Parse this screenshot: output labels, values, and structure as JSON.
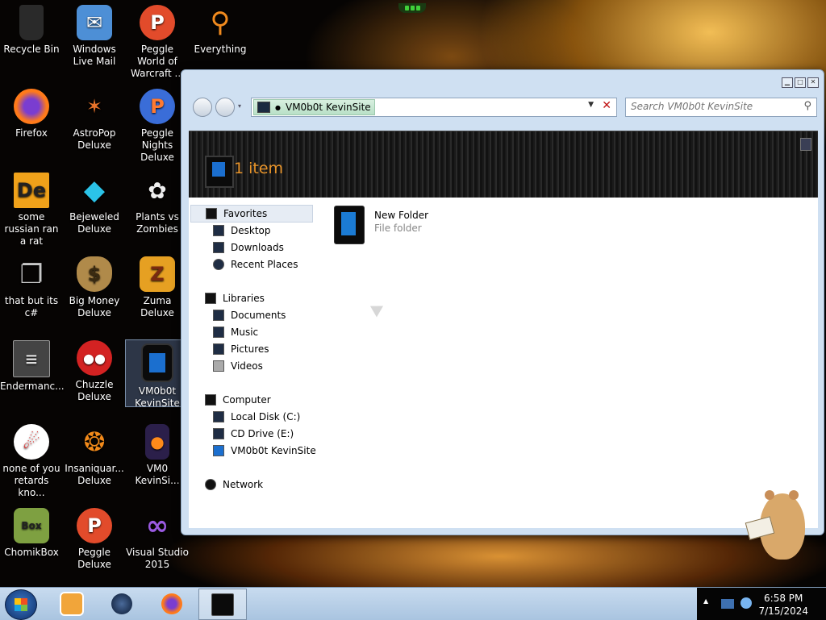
{
  "desktop": {
    "icons": [
      {
        "label": "Recycle Bin",
        "icon": "recycle-bin-icon",
        "color": "#2a2a2a"
      },
      {
        "label": "Windows Live Mail",
        "icon": "mail-icon",
        "color": "#4d8fd6"
      },
      {
        "label": "Peggle World of Warcraft ...",
        "icon": "peggle-icon",
        "color": "#e24b2b"
      },
      {
        "label": "Everything",
        "icon": "magnifier-icon",
        "color": "#f08a1e"
      },
      {
        "label": "Firefox",
        "icon": "firefox-icon",
        "color": "#ff7a1a"
      },
      {
        "label": "AstroPop Deluxe",
        "icon": "astropop-icon",
        "color": "#e8732a"
      },
      {
        "label": "Peggle Nights Deluxe",
        "icon": "peggle-icon",
        "color": "#3a6dd8"
      },
      {
        "label": "some russian ran a rat",
        "icon": "de-icon",
        "color": "#f0a21a"
      },
      {
        "label": "Bejeweled Deluxe",
        "icon": "gem-icon",
        "color": "#2bc3e8"
      },
      {
        "label": "Plants vs Zombies",
        "icon": "plant-icon",
        "color": "#5aa03a"
      },
      {
        "label": "that but its c#",
        "icon": "copy-icon",
        "color": "#c8c8c8"
      },
      {
        "label": "Big Money Deluxe",
        "icon": "money-bag-icon",
        "color": "#b08a4a"
      },
      {
        "label": "Zuma Deluxe",
        "icon": "zuma-icon",
        "color": "#e6a022"
      },
      {
        "label": "Endermanc...",
        "icon": "document-icon",
        "color": "#444444"
      },
      {
        "label": "Chuzzle Deluxe",
        "icon": "chuzzle-icon",
        "color": "#d32222"
      },
      {
        "label": "VM0b0t KevinSite",
        "icon": "vm-tablet-icon",
        "color": "#1b6fcf"
      },
      {
        "label": "none of you retards kno...",
        "icon": "dragon-icon",
        "color": "#e03030"
      },
      {
        "label": "Insaniquar... Deluxe",
        "icon": "fish-icon",
        "color": "#f28a1a"
      },
      {
        "label": "VM0 KevinSi...",
        "icon": "firefox-doc-icon",
        "color": "#8a5ae0"
      },
      {
        "label": "ChomikBox",
        "icon": "hamster-box-icon",
        "color": "#7ea041"
      },
      {
        "label": "Peggle Deluxe",
        "icon": "peggle-icon",
        "color": "#e24b2b"
      },
      {
        "label": "Visual Studio 2015",
        "icon": "visual-studio-icon",
        "color": "#7b3fbf"
      }
    ]
  },
  "window": {
    "address": "VM0b0t KevinSite",
    "search_placeholder": "Search VM0b0t KevinSite",
    "item_count": "1 item",
    "nav": {
      "favorites": {
        "header": "Favorites",
        "items": [
          "Desktop",
          "Downloads",
          "Recent Places"
        ]
      },
      "libraries": {
        "header": "Libraries",
        "items": [
          "Documents",
          "Music",
          "Pictures",
          "Videos"
        ]
      },
      "computer": {
        "header": "Computer",
        "items": [
          "Local Disk (C:)",
          "CD Drive (E:)",
          "VM0b0t KevinSite"
        ]
      },
      "network": {
        "header": "Network"
      }
    },
    "files": [
      {
        "name": "New Folder",
        "type": "File folder",
        "icon": "folder-tablet-icon"
      }
    ]
  },
  "taskbar": {
    "time": "6:58 PM",
    "date": "7/15/2024",
    "pinned": [
      "media-player-icon",
      "globe-icon",
      "firefox-icon",
      "explorer-icon"
    ]
  },
  "colors": {
    "accent_orange": "#e8942a",
    "taskbar": "#b8d0ea",
    "tray": "#050505"
  }
}
